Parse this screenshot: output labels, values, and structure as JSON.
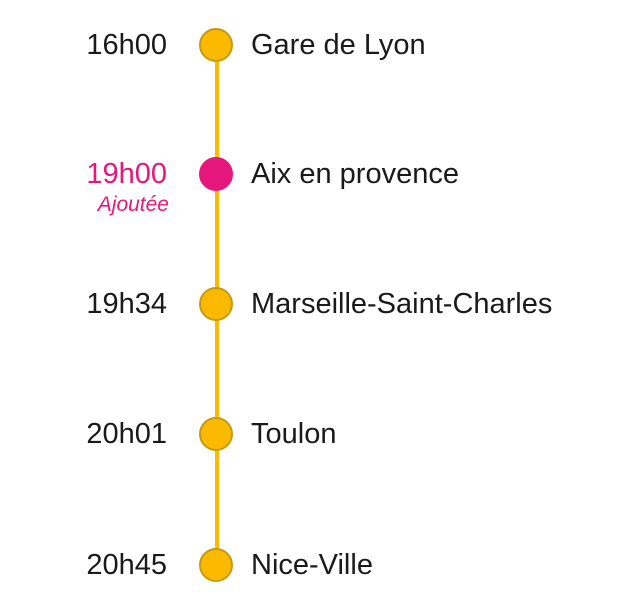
{
  "colors": {
    "line": "#FBBA00",
    "stop_fill": "#FBBA00",
    "stop_border": "#C69A10",
    "added": "#E6177C",
    "text": "#1a1a1a"
  },
  "stops": [
    {
      "time": "16h00",
      "station": "Gare de Lyon",
      "status": "regular",
      "note": ""
    },
    {
      "time": "19h00",
      "station": "Aix en provence",
      "status": "added",
      "note": "Ajoutée"
    },
    {
      "time": "19h34",
      "station": "Marseille-Saint-Charles",
      "status": "regular",
      "note": ""
    },
    {
      "time": "20h01",
      "station": "Toulon",
      "status": "regular",
      "note": ""
    },
    {
      "time": "20h45",
      "station": "Nice-Ville",
      "status": "regular",
      "note": ""
    }
  ]
}
